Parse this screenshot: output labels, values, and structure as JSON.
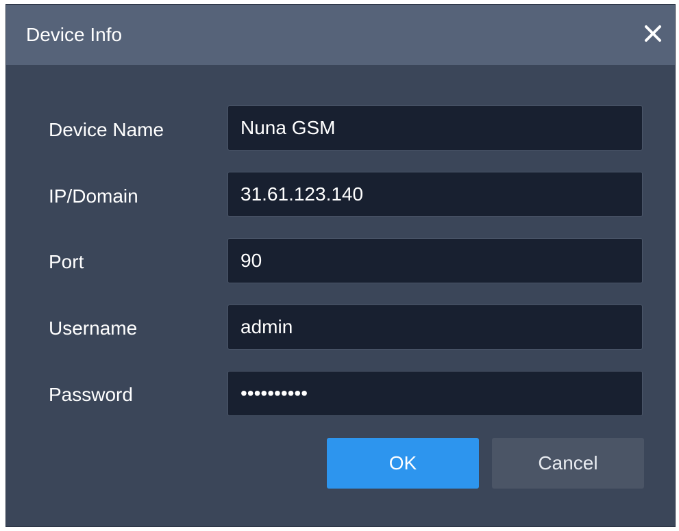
{
  "dialog": {
    "title": "Device Info",
    "close_icon": "close-icon"
  },
  "fields": {
    "device_name": {
      "label": "Device Name",
      "value": "Nuna GSM"
    },
    "ip_domain": {
      "label": "IP/Domain",
      "value": "31.61.123.140"
    },
    "port": {
      "label": "Port",
      "value": "90"
    },
    "username": {
      "label": "Username",
      "value": "admin"
    },
    "password": {
      "label": "Password",
      "value": "••••••••••"
    }
  },
  "buttons": {
    "ok_label": "OK",
    "cancel_label": "Cancel"
  },
  "colors": {
    "dialog_bg": "#3b4659",
    "titlebar_bg": "#566379",
    "input_bg": "#182030",
    "primary": "#2d95ee",
    "secondary": "#4b5566"
  }
}
